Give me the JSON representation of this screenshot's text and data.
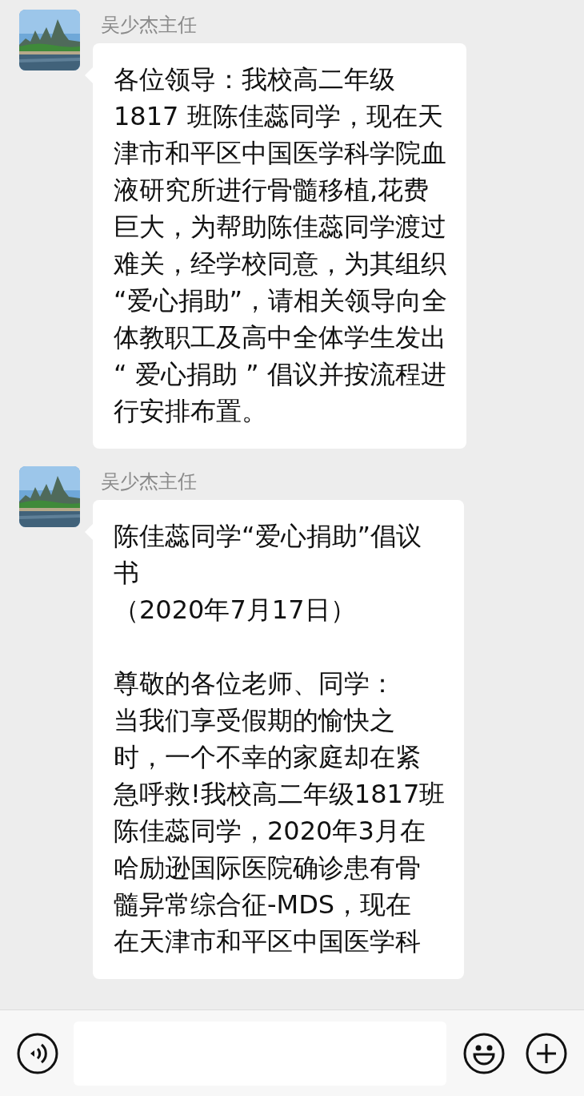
{
  "messages": [
    {
      "sender": "吴少杰主任",
      "paragraphs": [
        [
          "各位领导：我校高二年级",
          "1817 班陈佳蕊同学，现在天",
          "津市和平区中国医学科学院血",
          "液研究所进行骨髓移植,花费",
          "巨大，为帮助陈佳蕊同学渡过",
          "难关，经学校同意，为其组织",
          "“爱心捐助”，请相关领导向全",
          "体教职工及高中全体学生发出",
          "“ 爱心捐助 ” 倡议并按流程进",
          "行安排布置。"
        ]
      ]
    },
    {
      "sender": "吴少杰主任",
      "paragraphs": [
        [
          "陈佳蕊同学“爱心捐助”倡议",
          "书",
          "（2020年7月17日）"
        ],
        [
          "尊敬的各位老师、同学：",
          "当我们享受假期的愉快之",
          "时，一个不幸的家庭却在紧",
          "急呼救!我校高二年级1817班",
          "陈佳蕊同学，2020年3月在",
          "哈励逊国际医院确诊患有骨",
          "髓异常综合征-MDS，现在",
          "在天津市和平区中国医学科"
        ]
      ]
    }
  ]
}
